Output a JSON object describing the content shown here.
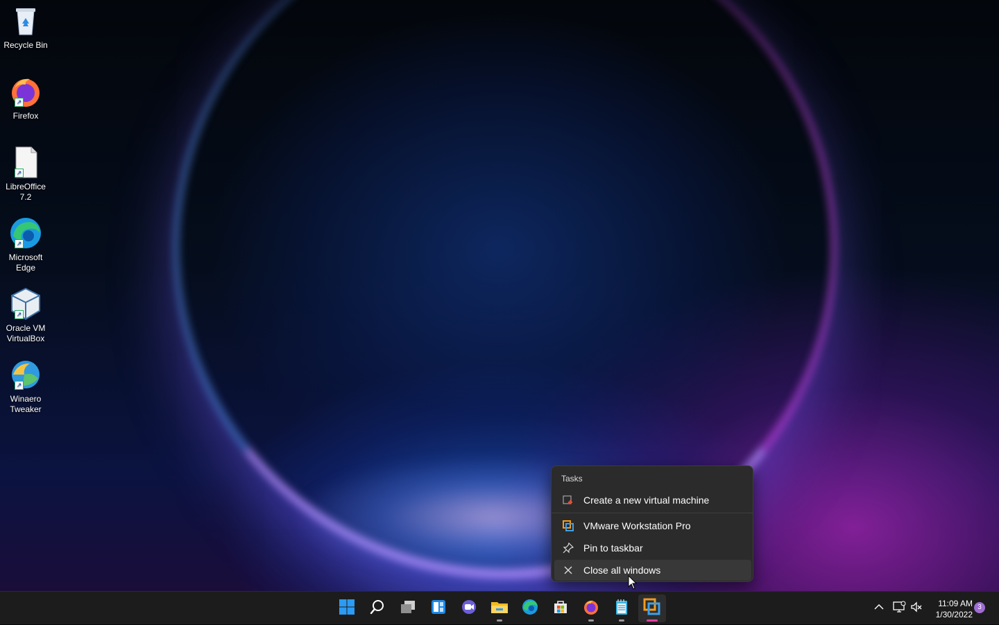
{
  "desktop": {
    "icons": [
      {
        "label": "Recycle Bin",
        "icon": "recycle-bin-icon"
      },
      {
        "label": "Firefox",
        "icon": "firefox-icon"
      },
      {
        "label": "LibreOffice 7.2",
        "icon": "libreoffice-icon"
      },
      {
        "label": "Microsoft Edge",
        "icon": "edge-icon"
      },
      {
        "label": "Oracle VM VirtualBox",
        "icon": "virtualbox-icon"
      },
      {
        "label": "Winaero Tweaker",
        "icon": "winaero-tweaker-icon"
      }
    ]
  },
  "jump_menu": {
    "section_title": "Tasks",
    "items": [
      {
        "label": "Create a new virtual machine",
        "icon": "new-vm-icon"
      },
      {
        "label": "VMware Workstation Pro",
        "icon": "vmware-icon"
      },
      {
        "label": "Pin to taskbar",
        "icon": "pin-icon"
      },
      {
        "label": "Close all windows",
        "icon": "close-icon"
      }
    ]
  },
  "taskbar": {
    "apps": [
      {
        "name": "Start",
        "icon": "windows-start-icon"
      },
      {
        "name": "Search",
        "icon": "search-icon"
      },
      {
        "name": "Task View",
        "icon": "task-view-icon"
      },
      {
        "name": "Widgets",
        "icon": "widgets-icon"
      },
      {
        "name": "Chat",
        "icon": "teams-chat-icon"
      },
      {
        "name": "File Explorer",
        "icon": "file-explorer-icon"
      },
      {
        "name": "Microsoft Edge",
        "icon": "edge-icon"
      },
      {
        "name": "Microsoft Store",
        "icon": "store-icon"
      },
      {
        "name": "Firefox",
        "icon": "firefox-icon"
      },
      {
        "name": "Notepad",
        "icon": "notepad-icon"
      },
      {
        "name": "VMware Workstation Pro",
        "icon": "vmware-icon"
      }
    ],
    "clock": {
      "time": "11:09 AM",
      "date": "1/30/2022"
    },
    "notifications": "3"
  },
  "colors": {
    "taskbar_bg": "#1c1c1c",
    "menu_bg": "#2b2b2b",
    "accent": "#0078d4",
    "active_indicator": "#e040a0"
  }
}
